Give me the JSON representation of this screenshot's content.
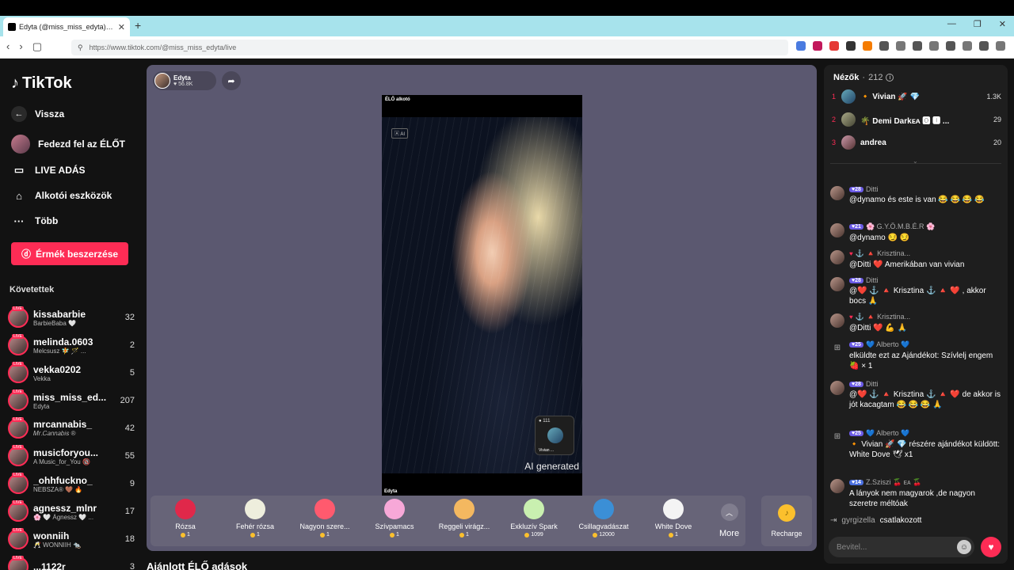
{
  "browser": {
    "tab_title": "Edyta (@miss_miss_edyta) Élő...",
    "new_tab": "+",
    "url": "https://www.tiktok.com/@miss_miss_edyta/live",
    "win_min": "—",
    "win_max": "❐",
    "win_close": "✕"
  },
  "sidebar": {
    "logo": "TikTok",
    "back": "Vissza",
    "explore_live": "Fedezd fel az ÉLŐT",
    "live_broadcast": "LIVE ADÁS",
    "creator_tools": "Alkotói eszközök",
    "more": "Több",
    "buy_coins": "Érmék beszerzése",
    "following_title": "Követettek",
    "following": [
      {
        "name": "kissabarbie",
        "sub": "BarbieBaba 🤍",
        "count": "32"
      },
      {
        "name": "melinda.0603",
        "sub": "Melcsusz 🧚 🪄 ...",
        "count": "2"
      },
      {
        "name": "vekka0202",
        "sub": "Vekka",
        "count": "5"
      },
      {
        "name": "miss_miss_ed...",
        "sub": "Edyta",
        "count": "207"
      },
      {
        "name": "mrcannabis_",
        "sub": "𝑀𝑟.𝐶𝑎𝑛𝑛𝑎𝑏𝑖𝑠 ®",
        "count": "42"
      },
      {
        "name": "musicforyou...",
        "sub": "A Music_for_You 🔞",
        "count": "55"
      },
      {
        "name": "_ohhfuckno_",
        "sub": "NEBSZA® 🤎 🔥",
        "count": "9"
      },
      {
        "name": "agnessz_mlnr",
        "sub": "🌸 🤍 Ágnessz 🤍 ...",
        "count": "17"
      },
      {
        "name": "wonniih",
        "sub": "🥂 WONNIIH 🐀",
        "count": "18"
      },
      {
        "name": "...1122r",
        "sub": "",
        "count": "3"
      }
    ],
    "live_badge": "LIVE"
  },
  "stage": {
    "host_name": "Edyta",
    "host_likes": "♥ 56.8K",
    "video_top_label": "ÉLŐ alkotó",
    "video_tag": "🄰 AI",
    "video_bottom_label": "Edyta",
    "ai_generated": "AI generated",
    "mini_count": "● 111",
    "mini_name": "Vivian ..."
  },
  "gifts": [
    {
      "name": "Rózsa",
      "price": "1",
      "color": "#e0284a"
    },
    {
      "name": "Fehér rózsa",
      "price": "1",
      "color": "#eeeedd"
    },
    {
      "name": "Nagyon szere...",
      "price": "1",
      "color": "#ff5a6e"
    },
    {
      "name": "Szívpamacs",
      "price": "1",
      "color": "#f7a8d8"
    },
    {
      "name": "Reggeli virágz...",
      "price": "1",
      "color": "#f4b860"
    },
    {
      "name": "Exkluzív Spark",
      "price": "1099",
      "color": "#c9f0b0"
    },
    {
      "name": "Csillagvadászat",
      "price": "12000",
      "color": "#3b8fd6"
    },
    {
      "name": "White Dove",
      "price": "1",
      "color": "#f4f4f4"
    }
  ],
  "gift_more": "More",
  "recharge": "Recharge",
  "recommended_title": "Ajánlott ÉLŐ adások",
  "chat": {
    "viewers_label": "Nézők",
    "viewers_count": "212",
    "top_viewers": [
      {
        "rank": "1",
        "name": "🔸 Vivian 🚀 💎",
        "score": "1.3K"
      },
      {
        "rank": "2",
        "name": "🌴 Demi Darkᴇᴀ 🅾 🅸 ...",
        "score": "29"
      },
      {
        "rank": "3",
        "name": "andrea",
        "score": "20"
      }
    ],
    "messages": [
      {
        "kind": "user",
        "badge": "28",
        "name": "Ditti",
        "text": "@dynamo és este is van 😂 😂 😂 😂"
      },
      {
        "kind": "user",
        "badge": "21",
        "name": "🌸 G.Y.Ö.M.B.É.R 🌸",
        "text": "@dynamo 😏 😏"
      },
      {
        "kind": "user",
        "badge": "",
        "name": "⚓ 🔺 Krisztina...",
        "text": "@Ditti ❤️ Amerikában van vivian"
      },
      {
        "kind": "user",
        "badge": "28",
        "name": "Ditti",
        "text": "@❤️ ⚓ 🔺 Krisztina ⚓ 🔺 ❤️ , akkor bocs 🙏"
      },
      {
        "kind": "user",
        "badge": "",
        "name": "⚓ 🔺 Krisztina...",
        "text": "@Ditti ❤️ 💪 🙏"
      },
      {
        "kind": "gift",
        "badge": "25",
        "name": "💙 Alberto 💙",
        "text": "elküldte ezt az Ajándékot: Szívlelj engem 🍓 × 1"
      },
      {
        "kind": "user",
        "badge": "28",
        "name": "Ditti",
        "text": "@❤️ ⚓ 🔺 Krisztina ⚓ 🔺 ❤️ de akkor is jót kacagtam 😂 😂 😂 🙏"
      },
      {
        "kind": "gift",
        "badge": "25",
        "name": "💙 Alberto 💙",
        "text": "🔸 Vivian 🚀 💎 részére ajándékot küldött: White Dove 🕊 x1"
      },
      {
        "kind": "user",
        "badge": "14",
        "name": "Z.Sziszi 🍒 ᴇᴀ 🍒",
        "text": "A lányok nem magyarok ,de nagyon szeretre méltóak"
      }
    ],
    "joined_name": "gyrgizella",
    "joined_text": "csatlakozott",
    "input_placeholder": "Bevitel..."
  }
}
